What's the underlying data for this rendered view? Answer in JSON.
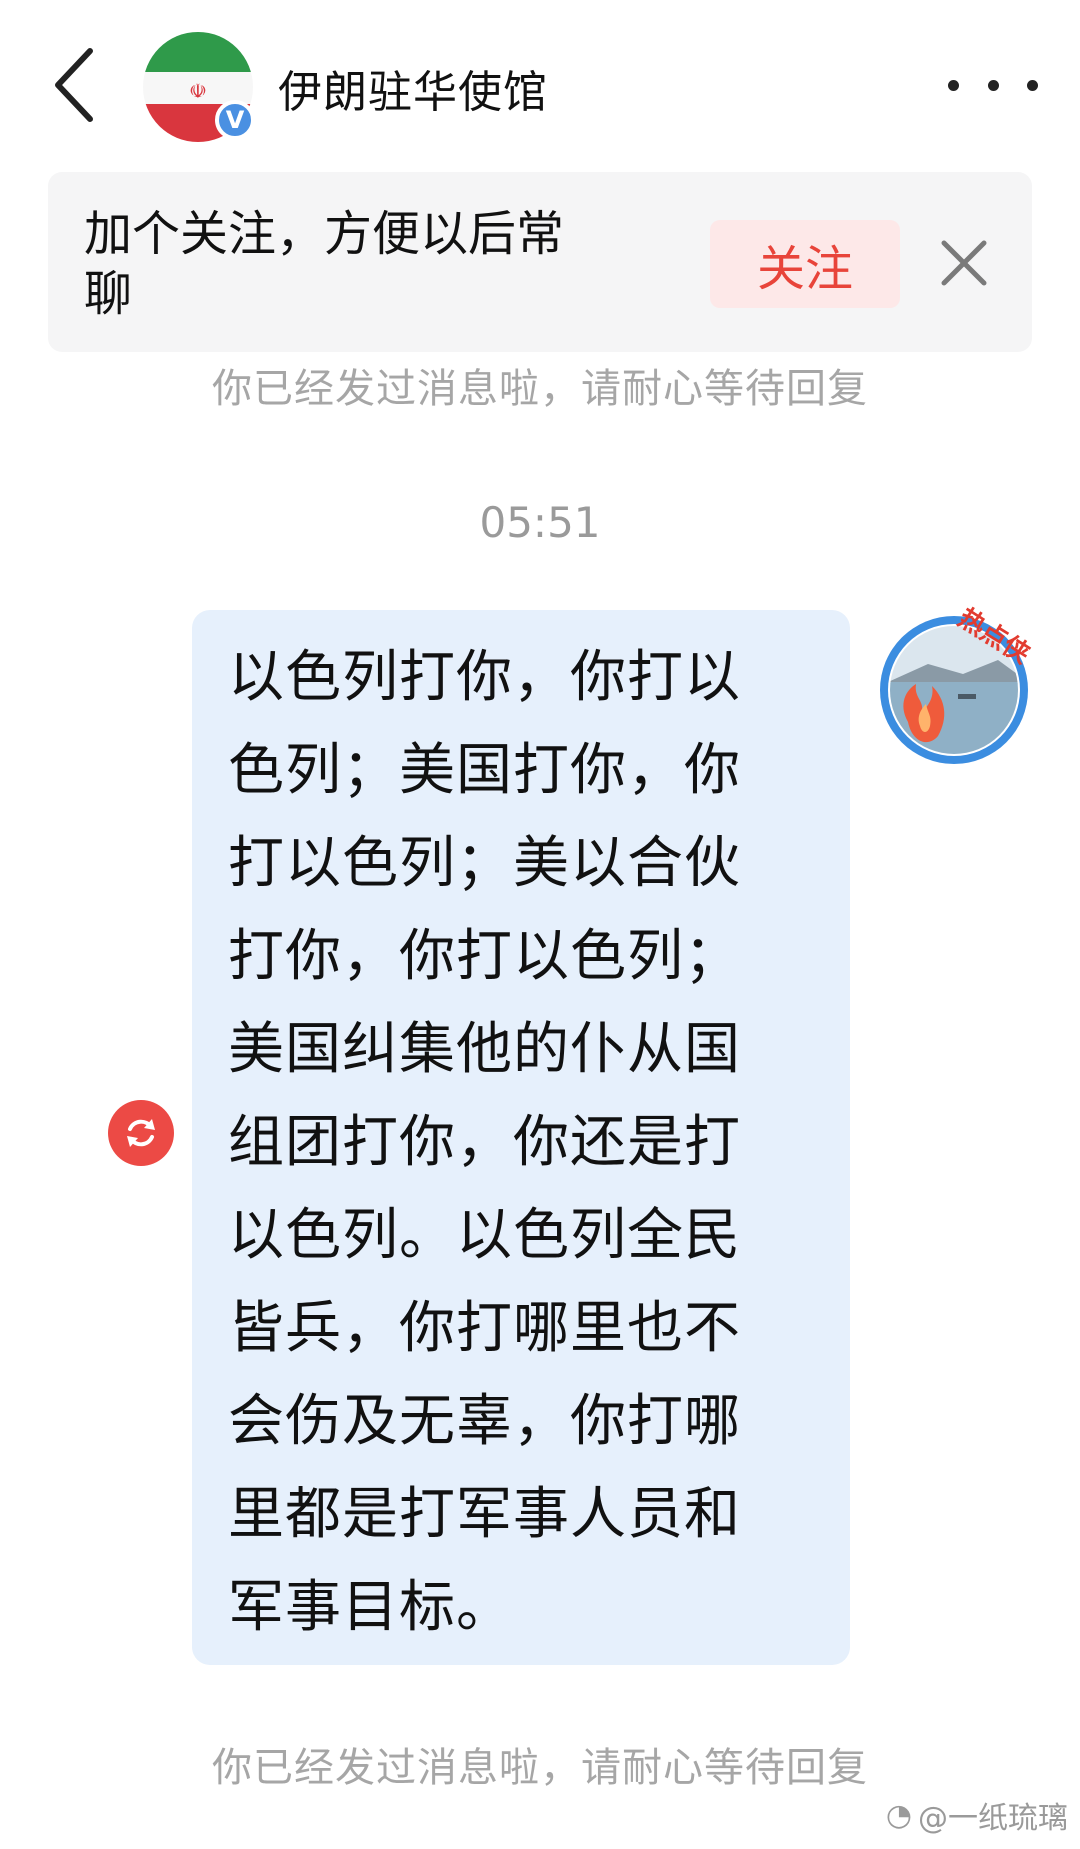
{
  "header": {
    "back_icon": "chevron-left-icon",
    "title": "伊朗驻华使馆",
    "verified_badge": "V",
    "more_icon": "more-dots-icon"
  },
  "follow_banner": {
    "text_line1": "加个关注，方便以后常",
    "text_line2": "聊",
    "follow_label": "关注",
    "close_icon": "close-icon"
  },
  "chat": {
    "system_note_top": "你已经发过消息啦，请耐心等待回复",
    "timestamp": "05:51",
    "message_lines": [
      "以色列打你，你打以",
      "色列；美国打你，你",
      "打以色列；美以合伙",
      "打你，你打以色列；",
      "美国纠集他的仆从国",
      "组团打你，你还是打",
      "以色列。以色列全民",
      "皆兵，你打哪里也不",
      "会伤及无辜，你打哪",
      "里都是打军事人员和",
      "军事目标。"
    ],
    "resend_icon": "resend-icon",
    "my_avatar_badge": "热点侠",
    "system_note_bottom": "你已经发过消息啦，请耐心等待回复"
  },
  "watermark": "@一纸琉璃",
  "colors": {
    "bubble": "#e6f0fc",
    "follow_text": "#e8443a",
    "follow_bg": "#fde8e8",
    "resend": "#ec4a45",
    "verified": "#4a90e2"
  }
}
